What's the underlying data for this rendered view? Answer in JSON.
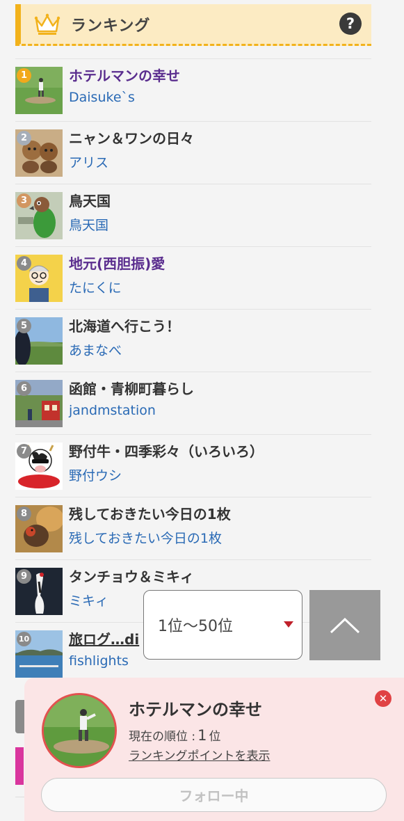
{
  "header": {
    "title": "ランキング",
    "help_label": "?",
    "icon": "crown-icon",
    "accent_color": "#f2b21b"
  },
  "ranking": [
    {
      "rank": "1",
      "title": "ホテルマンの幸せ",
      "author": "Daisuke`s",
      "visited": true,
      "badge": "gold"
    },
    {
      "rank": "2",
      "title": "ニャン＆ワンの日々",
      "author": "アリス",
      "visited": false,
      "badge": "silver"
    },
    {
      "rank": "3",
      "title": "鳥天国",
      "author": "鳥天国",
      "visited": false,
      "badge": "bronze"
    },
    {
      "rank": "4",
      "title": "地元(西胆振)愛",
      "author": "たにくに",
      "visited": true,
      "badge": "gray"
    },
    {
      "rank": "5",
      "title": "北海道へ行こう！",
      "author": "あまなべ",
      "visited": false,
      "badge": "gray"
    },
    {
      "rank": "6",
      "title": "函館・青柳町暮らし",
      "author": "jandmstation",
      "visited": false,
      "badge": "gray"
    },
    {
      "rank": "7",
      "title": "野付牛・四季彩々（いろいろ）",
      "author": "野付ウシ",
      "visited": false,
      "badge": "gray"
    },
    {
      "rank": "8",
      "title": "残しておきたい今日の1枚",
      "author": "残しておきたい今日の1枚",
      "visited": false,
      "badge": "gray"
    },
    {
      "rank": "9",
      "title": "タンチョウ＆ミキィ",
      "author": "ミキィ",
      "visited": false,
      "badge": "gray"
    },
    {
      "rank": "10",
      "title": "旅ログ…di",
      "author": "fishlights",
      "visited": false,
      "badge": "gray"
    }
  ],
  "range_select": {
    "selected": "1位〜50位"
  },
  "scroll_top": {
    "icon": "chevron-up-icon"
  },
  "popup": {
    "title": "ホテルマンの幸せ",
    "rank_prefix": "現在の順位 :",
    "rank_value": "1",
    "rank_suffix": "位",
    "points_link": "ランキングポイントを表示",
    "follow_label": "フォロー中",
    "close_icon": "close-icon",
    "accent_color": "#e2514f"
  }
}
